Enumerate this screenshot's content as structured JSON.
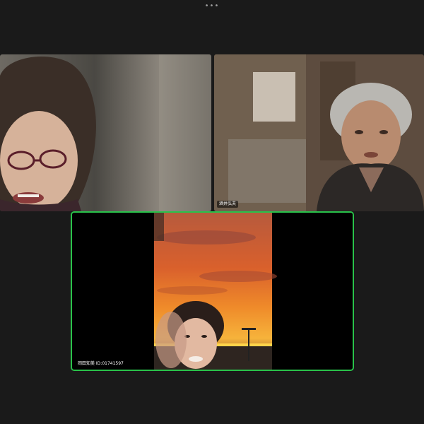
{
  "toolbar": {
    "more_icon": "more-options-icon",
    "more_glyph": "•••"
  },
  "participants": [
    {
      "name": ""
    },
    {
      "name": "酒井弘夫"
    },
    {
      "name": "岡田知美 ID:01741597"
    }
  ],
  "colors": {
    "active_speaker_border": "#29c24a",
    "background": "#1a1a1a"
  }
}
